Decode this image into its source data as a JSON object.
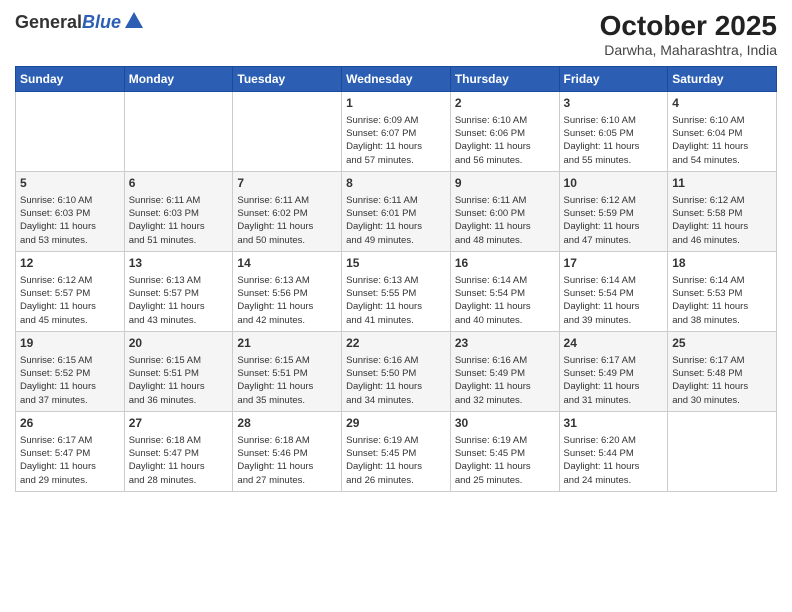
{
  "logo": {
    "general": "General",
    "blue": "Blue"
  },
  "header": {
    "month": "October 2025",
    "location": "Darwha, Maharashtra, India"
  },
  "weekdays": [
    "Sunday",
    "Monday",
    "Tuesday",
    "Wednesday",
    "Thursday",
    "Friday",
    "Saturday"
  ],
  "weeks": [
    [
      {
        "day": "",
        "info": ""
      },
      {
        "day": "",
        "info": ""
      },
      {
        "day": "",
        "info": ""
      },
      {
        "day": "1",
        "info": "Sunrise: 6:09 AM\nSunset: 6:07 PM\nDaylight: 11 hours\nand 57 minutes."
      },
      {
        "day": "2",
        "info": "Sunrise: 6:10 AM\nSunset: 6:06 PM\nDaylight: 11 hours\nand 56 minutes."
      },
      {
        "day": "3",
        "info": "Sunrise: 6:10 AM\nSunset: 6:05 PM\nDaylight: 11 hours\nand 55 minutes."
      },
      {
        "day": "4",
        "info": "Sunrise: 6:10 AM\nSunset: 6:04 PM\nDaylight: 11 hours\nand 54 minutes."
      }
    ],
    [
      {
        "day": "5",
        "info": "Sunrise: 6:10 AM\nSunset: 6:03 PM\nDaylight: 11 hours\nand 53 minutes."
      },
      {
        "day": "6",
        "info": "Sunrise: 6:11 AM\nSunset: 6:03 PM\nDaylight: 11 hours\nand 51 minutes."
      },
      {
        "day": "7",
        "info": "Sunrise: 6:11 AM\nSunset: 6:02 PM\nDaylight: 11 hours\nand 50 minutes."
      },
      {
        "day": "8",
        "info": "Sunrise: 6:11 AM\nSunset: 6:01 PM\nDaylight: 11 hours\nand 49 minutes."
      },
      {
        "day": "9",
        "info": "Sunrise: 6:11 AM\nSunset: 6:00 PM\nDaylight: 11 hours\nand 48 minutes."
      },
      {
        "day": "10",
        "info": "Sunrise: 6:12 AM\nSunset: 5:59 PM\nDaylight: 11 hours\nand 47 minutes."
      },
      {
        "day": "11",
        "info": "Sunrise: 6:12 AM\nSunset: 5:58 PM\nDaylight: 11 hours\nand 46 minutes."
      }
    ],
    [
      {
        "day": "12",
        "info": "Sunrise: 6:12 AM\nSunset: 5:57 PM\nDaylight: 11 hours\nand 45 minutes."
      },
      {
        "day": "13",
        "info": "Sunrise: 6:13 AM\nSunset: 5:57 PM\nDaylight: 11 hours\nand 43 minutes."
      },
      {
        "day": "14",
        "info": "Sunrise: 6:13 AM\nSunset: 5:56 PM\nDaylight: 11 hours\nand 42 minutes."
      },
      {
        "day": "15",
        "info": "Sunrise: 6:13 AM\nSunset: 5:55 PM\nDaylight: 11 hours\nand 41 minutes."
      },
      {
        "day": "16",
        "info": "Sunrise: 6:14 AM\nSunset: 5:54 PM\nDaylight: 11 hours\nand 40 minutes."
      },
      {
        "day": "17",
        "info": "Sunrise: 6:14 AM\nSunset: 5:54 PM\nDaylight: 11 hours\nand 39 minutes."
      },
      {
        "day": "18",
        "info": "Sunrise: 6:14 AM\nSunset: 5:53 PM\nDaylight: 11 hours\nand 38 minutes."
      }
    ],
    [
      {
        "day": "19",
        "info": "Sunrise: 6:15 AM\nSunset: 5:52 PM\nDaylight: 11 hours\nand 37 minutes."
      },
      {
        "day": "20",
        "info": "Sunrise: 6:15 AM\nSunset: 5:51 PM\nDaylight: 11 hours\nand 36 minutes."
      },
      {
        "day": "21",
        "info": "Sunrise: 6:15 AM\nSunset: 5:51 PM\nDaylight: 11 hours\nand 35 minutes."
      },
      {
        "day": "22",
        "info": "Sunrise: 6:16 AM\nSunset: 5:50 PM\nDaylight: 11 hours\nand 34 minutes."
      },
      {
        "day": "23",
        "info": "Sunrise: 6:16 AM\nSunset: 5:49 PM\nDaylight: 11 hours\nand 32 minutes."
      },
      {
        "day": "24",
        "info": "Sunrise: 6:17 AM\nSunset: 5:49 PM\nDaylight: 11 hours\nand 31 minutes."
      },
      {
        "day": "25",
        "info": "Sunrise: 6:17 AM\nSunset: 5:48 PM\nDaylight: 11 hours\nand 30 minutes."
      }
    ],
    [
      {
        "day": "26",
        "info": "Sunrise: 6:17 AM\nSunset: 5:47 PM\nDaylight: 11 hours\nand 29 minutes."
      },
      {
        "day": "27",
        "info": "Sunrise: 6:18 AM\nSunset: 5:47 PM\nDaylight: 11 hours\nand 28 minutes."
      },
      {
        "day": "28",
        "info": "Sunrise: 6:18 AM\nSunset: 5:46 PM\nDaylight: 11 hours\nand 27 minutes."
      },
      {
        "day": "29",
        "info": "Sunrise: 6:19 AM\nSunset: 5:45 PM\nDaylight: 11 hours\nand 26 minutes."
      },
      {
        "day": "30",
        "info": "Sunrise: 6:19 AM\nSunset: 5:45 PM\nDaylight: 11 hours\nand 25 minutes."
      },
      {
        "day": "31",
        "info": "Sunrise: 6:20 AM\nSunset: 5:44 PM\nDaylight: 11 hours\nand 24 minutes."
      },
      {
        "day": "",
        "info": ""
      }
    ]
  ]
}
